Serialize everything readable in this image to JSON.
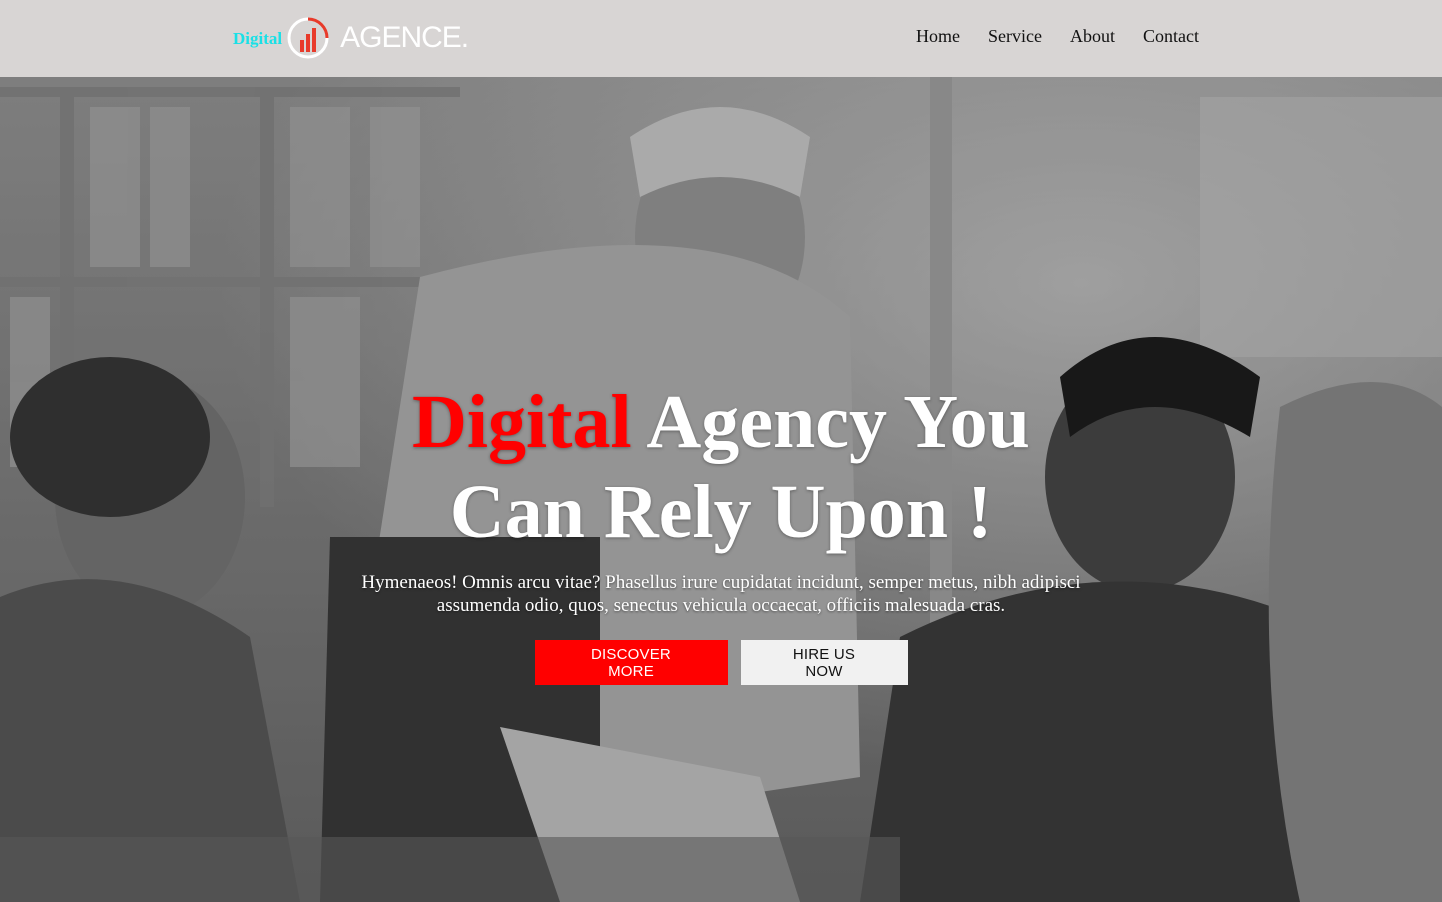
{
  "header": {
    "brand_small": "Digital",
    "brand_name": "AGENCE.",
    "logo_icon": "bar-chart-circle-icon",
    "nav": [
      {
        "label": "Home"
      },
      {
        "label": "Service"
      },
      {
        "label": "About"
      },
      {
        "label": "Contact"
      }
    ]
  },
  "hero": {
    "headline_accent": "Digital",
    "headline_rest": " Agency You Can Rely Upon !",
    "subtext": "Hymenaeos! Omnis arcu vitae? Phasellus irure cupidatat incidunt, semper metus, nibh adipisci assumenda odio, quos, senectus vehicula occaecat, officiis malesuada cras.",
    "primary_button": "DISCOVER MORE",
    "secondary_button": "HIRE US NOW"
  },
  "colors": {
    "accent": "#ff0000",
    "brand_small": "#19e0e6",
    "header_bg": "#d8d5d4"
  }
}
